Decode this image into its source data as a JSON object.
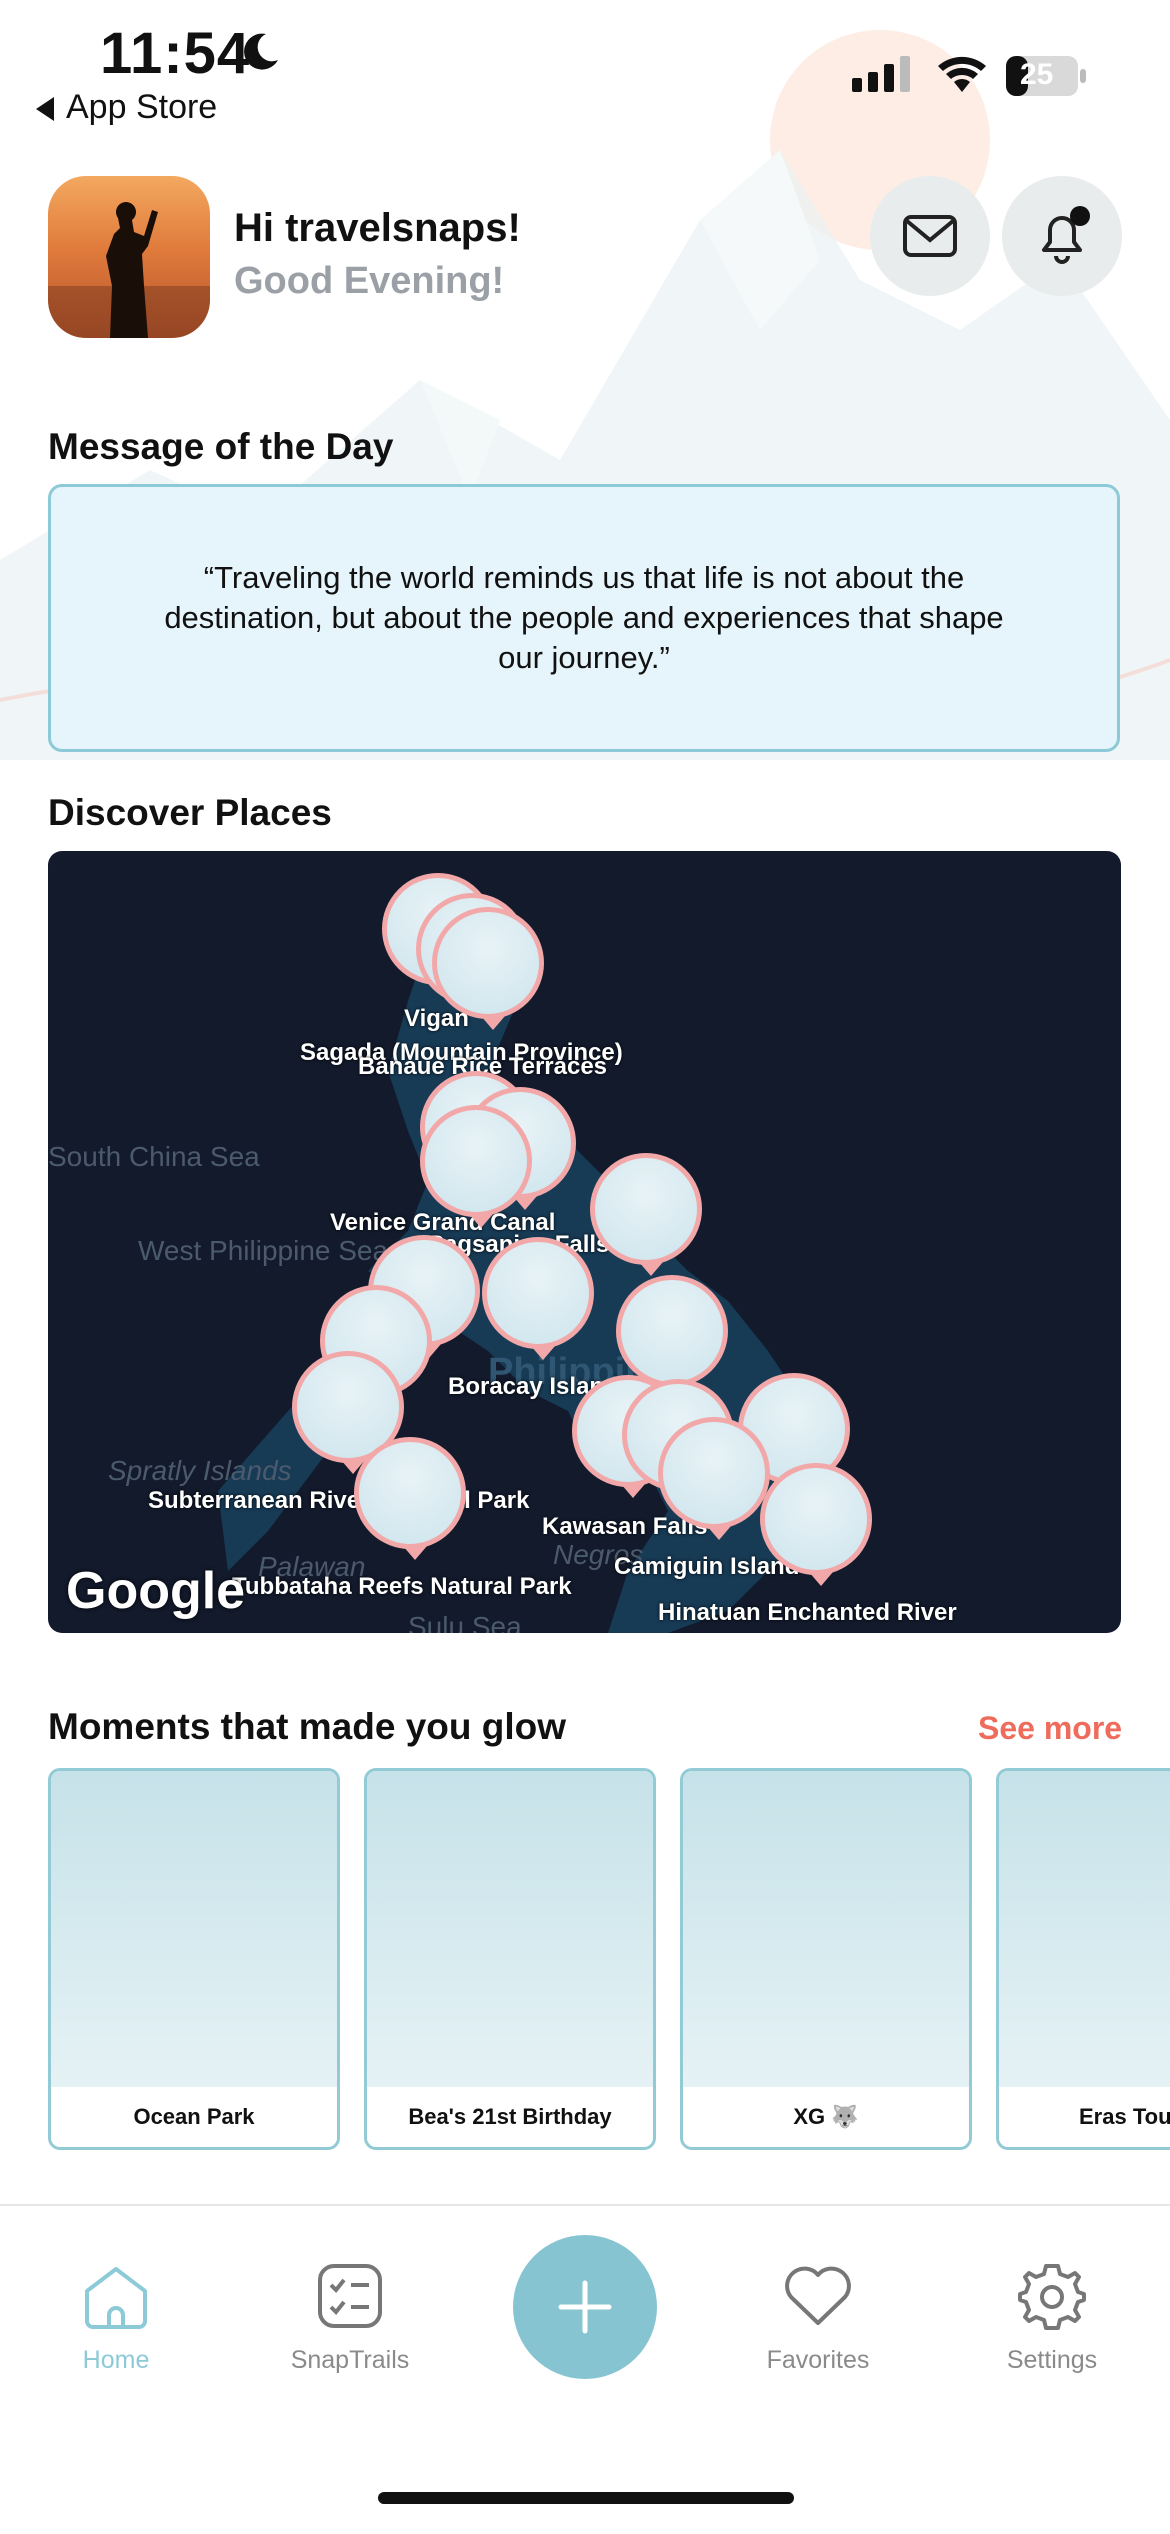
{
  "status_bar": {
    "time": "11:54",
    "back_label": "App Store",
    "battery": "25"
  },
  "header": {
    "greeting": "Hi travelsnaps!",
    "subgreeting": "Good Evening!",
    "icons": [
      "mail-icon",
      "bell-icon"
    ]
  },
  "motd": {
    "title": "Message of the Day",
    "quote": "“Traveling the world reminds us that life is not about the destination, but about the people and experiences that shape our journey.”"
  },
  "discover": {
    "title": "Discover Places",
    "map_labels": [
      "Vigan",
      "Sagada (Mountain Province)",
      "Banaue Rice Terraces",
      "Venice Grand Canal",
      "Pagsanjan Falls",
      "Boracay Island",
      "Subterranean River National Park",
      "Kawasan Falls",
      "Camiguin Island",
      "Tubbataha Reefs Natural Park",
      "Hinatuan Enchanted River"
    ],
    "sea_labels": [
      "South China Sea",
      "West Philippine Sea",
      "Spratly Islands",
      "Palawan",
      "Sulu Sea",
      "Negros",
      "Philippines"
    ],
    "attribution": "Google"
  },
  "moments": {
    "title": "Moments that made you glow",
    "see_more": "See more",
    "cards": [
      {
        "label": "Ocean Park"
      },
      {
        "label": "Bea's 21st Birthday"
      },
      {
        "label": "XG 🐺"
      },
      {
        "label": "Eras Tour"
      }
    ]
  },
  "tabbar": {
    "items": [
      {
        "label": "Home",
        "icon": "home-icon",
        "active": true
      },
      {
        "label": "SnapTrails",
        "icon": "checklist-icon",
        "active": false
      },
      {
        "label": "Favorites",
        "icon": "heart-icon",
        "active": false
      },
      {
        "label": "Settings",
        "icon": "gear-icon",
        "active": false
      }
    ],
    "fab_icon": "plus-icon"
  },
  "colors": {
    "accent": "#87c4d2",
    "see_more": "#ef6b5b",
    "motd_bg": "#e6f5fb",
    "map_bg": "#121a2c",
    "pin_border": "#f2a8a8"
  }
}
